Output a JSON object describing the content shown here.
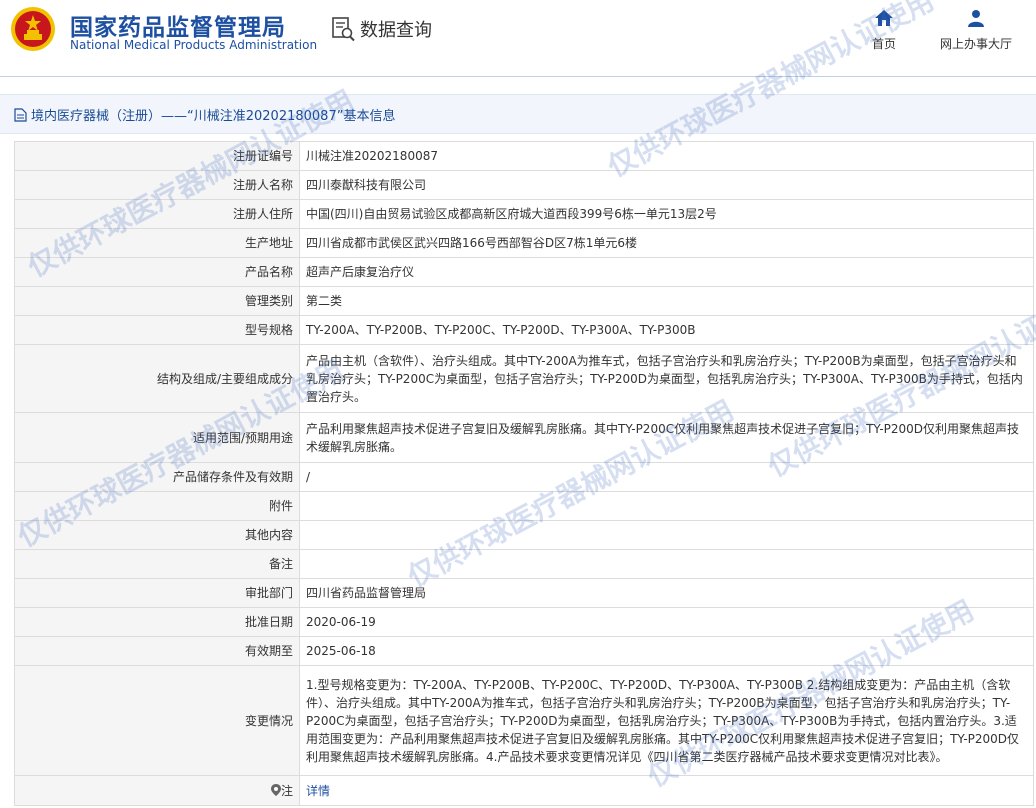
{
  "header": {
    "brand_cn": "国家药品监督管理局",
    "brand_en": "National Medical Products Administration",
    "query_label": "数据查询",
    "nav": [
      {
        "label": "首页",
        "icon": "home-icon"
      },
      {
        "label": "网上办事大厅",
        "icon": "user-icon"
      }
    ]
  },
  "breadcrumb": "境内医疗器械（注册）——“川械注准20202180087”基本信息",
  "rows": [
    {
      "key": "注册证编号",
      "value": "川械注准20202180087"
    },
    {
      "key": "注册人名称",
      "value": "四川泰猷科技有限公司"
    },
    {
      "key": "注册人住所",
      "value": "中国(四川)自由贸易试验区成都高新区府城大道西段399号6栋一单元13层2号"
    },
    {
      "key": "生产地址",
      "value": "四川省成都市武侯区武兴四路166号西部智谷D区7栋1单元6楼"
    },
    {
      "key": "产品名称",
      "value": "超声产后康复治疗仪"
    },
    {
      "key": "管理类别",
      "value": "第二类"
    },
    {
      "key": "型号规格",
      "value": "TY-200A、TY-P200B、TY-P200C、TY-P200D、TY-P300A、TY-P300B"
    },
    {
      "key": "结构及组成/主要组成成分",
      "value": "产品由主机（含软件）、治疗头组成。其中TY-200A为推车式，包括子宫治疗头和乳房治疗头；TY-P200B为桌面型，包括子宫治疗头和乳房治疗头；TY-P200C为桌面型，包括子宫治疗头；TY-P200D为桌面型，包括乳房治疗头；TY-P300A、TY-P300B为手持式，包括内置治疗头。"
    },
    {
      "key": "适用范围/预期用途",
      "value": "产品利用聚焦超声技术促进子宫复旧及缓解乳房胀痛。其中TY-P200C仅利用聚焦超声技术促进子宫复旧；TY-P200D仅利用聚焦超声技术缓解乳房胀痛。"
    },
    {
      "key": "产品储存条件及有效期",
      "value": "/"
    },
    {
      "key": "附件",
      "value": ""
    },
    {
      "key": "其他内容",
      "value": ""
    },
    {
      "key": "备注",
      "value": ""
    },
    {
      "key": "审批部门",
      "value": "四川省药品监督管理局"
    },
    {
      "key": "批准日期",
      "value": "2020-06-19"
    },
    {
      "key": "有效期至",
      "value": "2025-06-18"
    },
    {
      "key": "变更情况",
      "value": "1.型号规格变更为：TY-200A、TY-P200B、TY-P200C、TY-P200D、TY-P300A、TY-P300B 2.结构组成变更为：产品由主机（含软件）、治疗头组成。其中TY-200A为推车式，包括子宫治疗头和乳房治疗头；TY-P200B为桌面型，包括子宫治疗头和乳房治疗头；TY-P200C为桌面型，包括子宫治疗头；TY-P200D为桌面型，包括乳房治疗头；TY-P300A、TY-P300B为手持式，包括内置治疗头。3.适用范围变更为：产品利用聚焦超声技术促进子宫复旧及缓解乳房胀痛。其中TY-P200C仅利用聚焦超声技术促进子宫复旧；TY-P200D仅利用聚焦超声技术缓解乳房胀痛。4.产品技术要求变更情况详见《四川省第二类医疗器械产品技术要求变更情况对比表》。"
    }
  ],
  "note": {
    "key": "注",
    "value": "详情"
  },
  "watermark": "仅供环球医疗器械网认证使用",
  "colors": {
    "brand_blue": "#1e50a2",
    "emblem_red": "#c8161d",
    "emblem_gold": "#f2c200"
  }
}
